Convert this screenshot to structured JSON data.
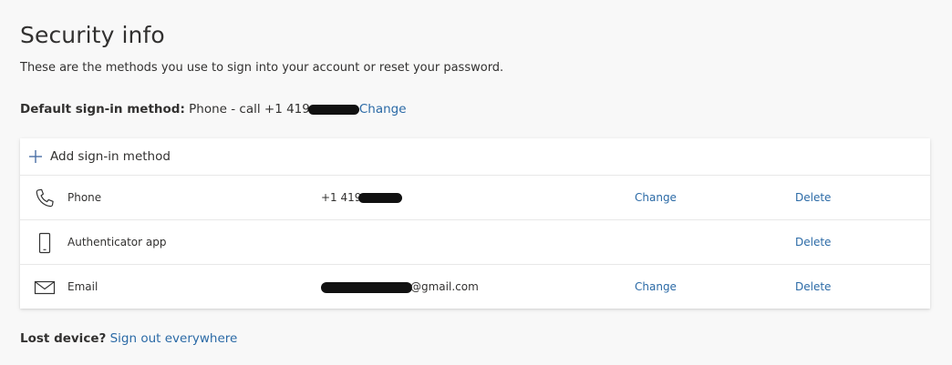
{
  "page": {
    "title": "Security info",
    "description": "These are the methods you use to sign into your account or reset your password."
  },
  "default_method": {
    "label": "Default sign-in method:",
    "value": "Phone - call +1 419",
    "change_label": "Change"
  },
  "add_method": {
    "label": "Add sign-in method",
    "icon": "plus-icon"
  },
  "methods": [
    {
      "icon": "phone-icon",
      "name": "Phone",
      "value": "+1 419",
      "change_label": "Change",
      "delete_label": "Delete"
    },
    {
      "icon": "mobile-device-icon",
      "name": "Authenticator app",
      "value": "",
      "change_label": "",
      "delete_label": "Delete"
    },
    {
      "icon": "mail-icon",
      "name": "Email",
      "value": "@gmail.com",
      "change_label": "Change",
      "delete_label": "Delete"
    }
  ],
  "footer": {
    "lost_label": "Lost device?",
    "sign_out_label": "Sign out everywhere"
  },
  "colors": {
    "link": "#2b6aa6",
    "text": "#323130",
    "background": "#f8f8f8",
    "redaction": "#111111"
  }
}
